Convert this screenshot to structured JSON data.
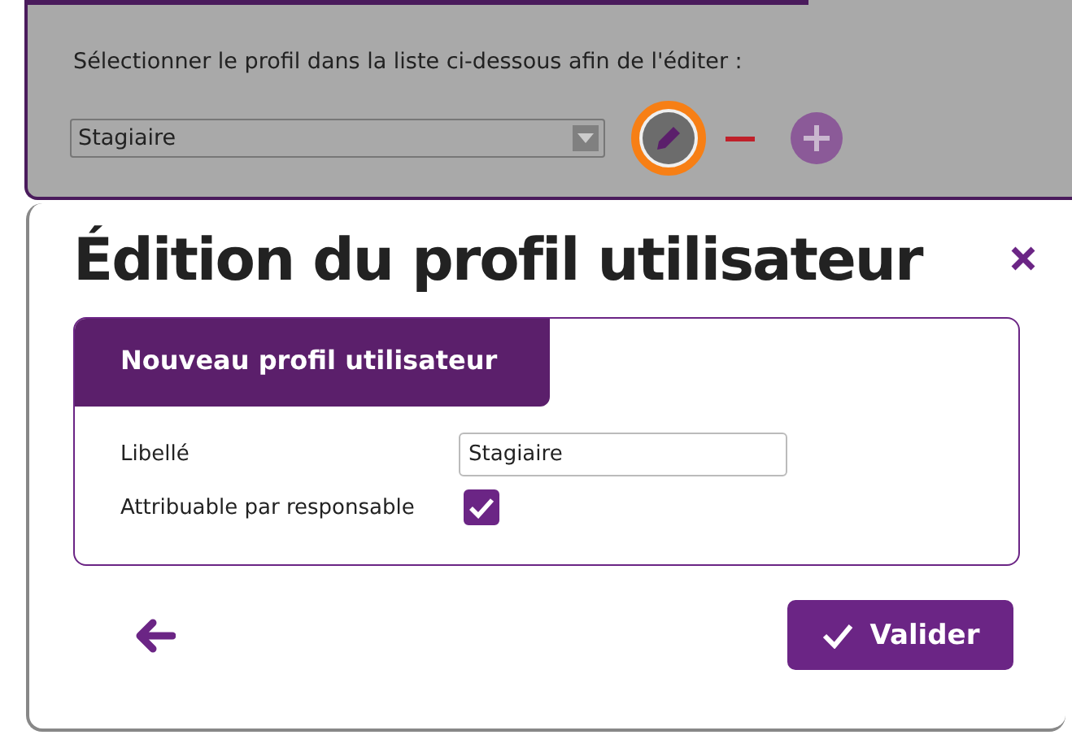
{
  "background_panel": {
    "instruction": "Sélectionner le profil dans la liste ci-dessous afin de l'éditer :",
    "profile_select": {
      "value": "Stagiaire"
    },
    "edit_button": {
      "highlighted": true
    },
    "remove_button": {
      "disabled": false
    },
    "add_button": {
      "disabled": true
    }
  },
  "dialog": {
    "title": "Édition du profil utilisateur",
    "tab": {
      "label": "Nouveau profil utilisateur"
    },
    "fields": [
      {
        "kind": "text",
        "label": "Libellé",
        "value": "Stagiaire"
      },
      {
        "kind": "checkbox",
        "label": "Attribuable par responsable",
        "checked": true
      }
    ],
    "submit_button": {
      "label": "Valider"
    }
  }
}
